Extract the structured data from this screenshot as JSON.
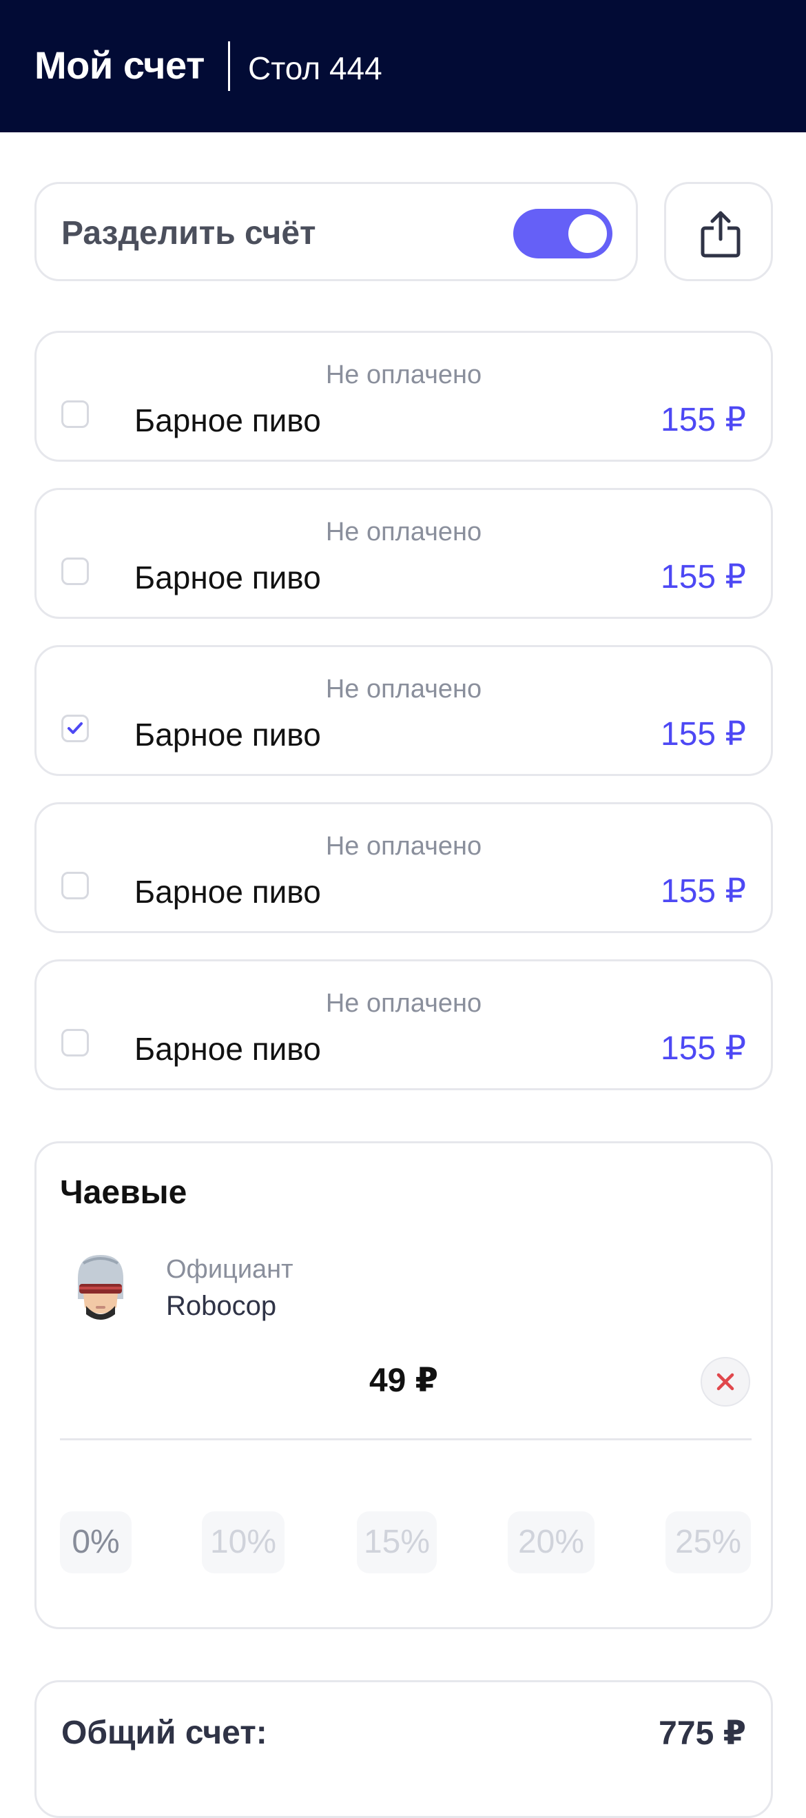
{
  "header": {
    "title": "Мой счет",
    "table": "Стол 444"
  },
  "split": {
    "label": "Разделить счёт",
    "enabled": true,
    "share_icon": "share-icon"
  },
  "items": [
    {
      "status": "Не оплачено",
      "name": "Барное пиво",
      "price": "155 ₽",
      "checked": false
    },
    {
      "status": "Не оплачено",
      "name": "Барное пиво",
      "price": "155 ₽",
      "checked": false
    },
    {
      "status": "Не оплачено",
      "name": "Барное пиво",
      "price": "155 ₽",
      "checked": true
    },
    {
      "status": "Не оплачено",
      "name": "Барное пиво",
      "price": "155 ₽",
      "checked": false
    },
    {
      "status": "Не оплачено",
      "name": "Барное пиво",
      "price": "155 ₽",
      "checked": false
    }
  ],
  "tips": {
    "title": "Чаевые",
    "waiter_role": "Официант",
    "waiter_name": "Robocop",
    "amount": "49 ₽",
    "percentages": [
      "0%",
      "10%",
      "15%",
      "20%",
      "25%"
    ],
    "selected": "0%"
  },
  "total": {
    "label": "Общий счет:",
    "value": "775 ₽"
  },
  "colors": {
    "header_bg": "#020b35",
    "accent": "#4d48f4",
    "toggle": "#6560f7",
    "clear": "#e0474c"
  }
}
